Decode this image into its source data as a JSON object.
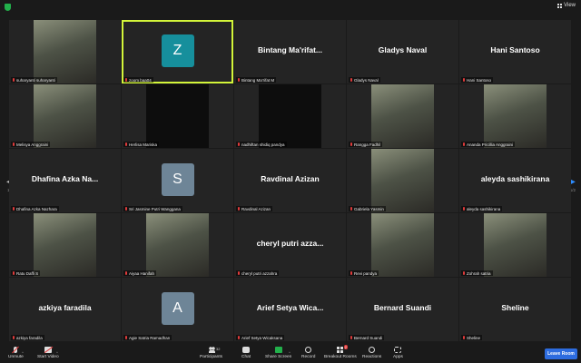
{
  "topbar": {
    "view_label": "View"
  },
  "pager": {
    "left": "1/2",
    "right": "1/2"
  },
  "tiles": [
    {
      "big_name": "",
      "label": "suharyanti suharyanti",
      "avatar": "",
      "photo": "person-photo"
    },
    {
      "big_name": "",
      "label": "zoom baa04",
      "avatar": "Z",
      "avatar_color": "#168f9c",
      "active": true
    },
    {
      "big_name": "Bintang Ma'rifat...",
      "label": "Bintang Ma'rifat M"
    },
    {
      "big_name": "Gladys Naval",
      "label": "Gladys Naval"
    },
    {
      "big_name": "Hani Santoso",
      "label": "Hani Santoso"
    },
    {
      "big_name": "",
      "label": "Melisya Anggraini",
      "photo": "person-photo"
    },
    {
      "big_name": "",
      "label": "Herlisa Mariska",
      "photo": "dark-video"
    },
    {
      "big_name": "",
      "label": "nadhiftan shidiq pandya",
      "photo": "dark-video"
    },
    {
      "big_name": "",
      "label": "Rangga Fadhil",
      "photo": "person-photo"
    },
    {
      "big_name": "",
      "label": "Ananda Pricillia Anggraini",
      "photo": "person-photo"
    },
    {
      "big_name": "Dhafina Azka Na...",
      "label": "Dhafina Azka Nazhara"
    },
    {
      "big_name": "",
      "label": "Sri Jasmine Putri Wanggana",
      "avatar": "S",
      "avatar_color": "#6e8597"
    },
    {
      "big_name": "Ravdinal Azizan",
      "label": "Ravdinal Azizan"
    },
    {
      "big_name": "",
      "label": "Gabriela Yasmin",
      "photo": "person-photo"
    },
    {
      "big_name": "aleyda sashikirana",
      "label": "aleyda sashikirana"
    },
    {
      "big_name": "",
      "label": "Ratu Daffi S",
      "photo": "person-photo"
    },
    {
      "big_name": "",
      "label": "Aiyaa Hanifah",
      "photo": "person-photo"
    },
    {
      "big_name": "cheryl putri azza...",
      "label": "cheryl putri azzahra"
    },
    {
      "big_name": "",
      "label": "Revi pandya",
      "photo": "person-photo"
    },
    {
      "big_name": "",
      "label": "Zohrah satria",
      "photo": "person-photo"
    },
    {
      "big_name": "azkiya faradila",
      "label": "azkiya faradila"
    },
    {
      "big_name": "",
      "label": "Agie Satria Ramadhan",
      "avatar": "A",
      "avatar_color": "#6e8597"
    },
    {
      "big_name": "Arief Setya Wica...",
      "label": "Arief Setya Wicaksana"
    },
    {
      "big_name": "Bernard Suandi",
      "label": "Bernard Suandi"
    },
    {
      "big_name": "Sheline",
      "label": "Sheline"
    }
  ],
  "toolbar": {
    "unmute": "Unmute",
    "start_video": "Start Video",
    "participants": "Participants",
    "participants_count": "32",
    "chat": "Chat",
    "share_screen": "Share Screen",
    "record": "Record",
    "breakout_rooms": "Breakout Rooms",
    "breakout_badge": "2",
    "reactions": "Reactions",
    "apps": "Apps",
    "leave": "Leave Room"
  },
  "colors": {
    "active_border": "#d3f53a",
    "share_green": "#22b04b",
    "leave_blue": "#2d6cdf",
    "arrow_blue": "#2d8cff"
  }
}
